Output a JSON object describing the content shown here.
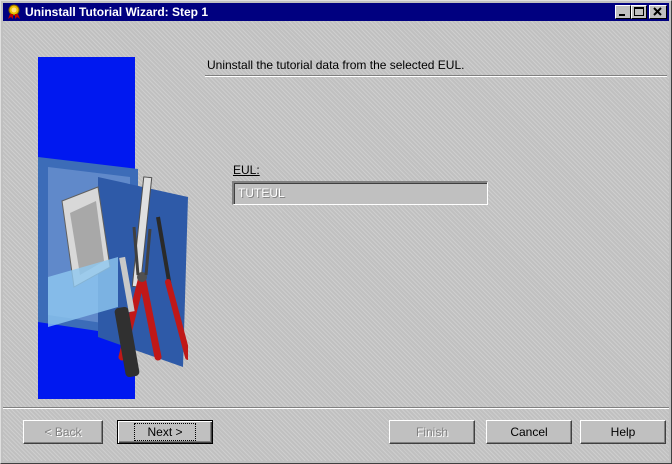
{
  "window": {
    "title": "Uninstall Tutorial Wizard: Step 1",
    "icon": "wizard-ribbon-icon"
  },
  "header": {
    "instruction": "Uninstall the tutorial data from the selected EUL."
  },
  "form": {
    "eul_label": "EUL:",
    "eul_value": "TUTEUL"
  },
  "buttons": {
    "back_label": "< Back",
    "next_label": "Next >",
    "finish_label": "Finish",
    "cancel_label": "Cancel",
    "help_label": "Help"
  },
  "colors": {
    "titlebar": "#000080",
    "art_panel": "#0018f0",
    "dialog": "#c0c0c0"
  }
}
